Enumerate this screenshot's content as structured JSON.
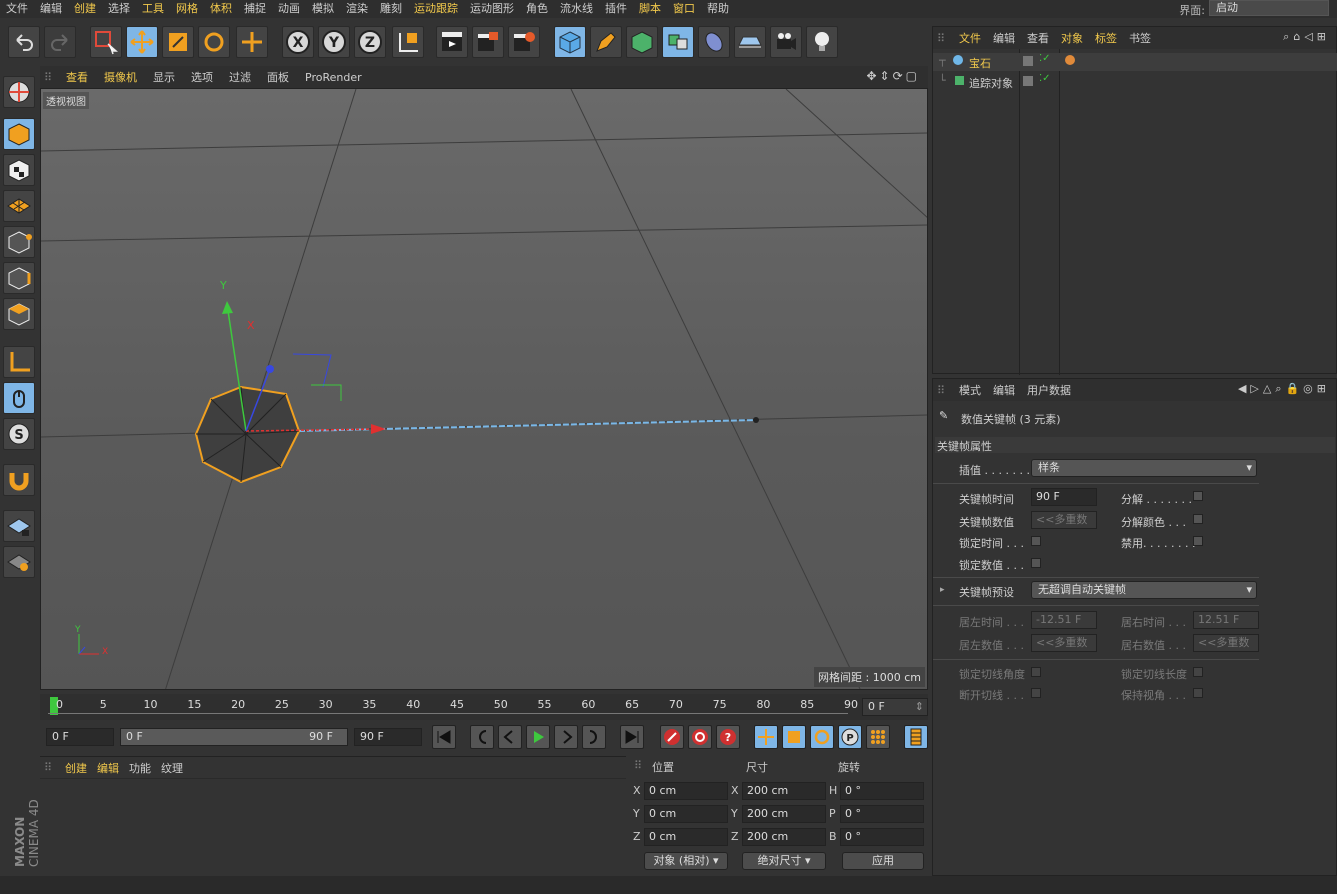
{
  "menubar": {
    "items": [
      "文件",
      "编辑",
      "创建",
      "选择",
      "工具",
      "网格",
      "体积",
      "捕捉",
      "动画",
      "模拟",
      "渲染",
      "雕刻",
      "运动跟踪",
      "运动图形",
      "角色",
      "流水线",
      "插件",
      "脚本",
      "窗口",
      "帮助"
    ],
    "highlighted": [
      "创建",
      "工具",
      "网格",
      "体积",
      "运动跟踪",
      "脚本",
      "窗口"
    ],
    "layout_label": "界面:",
    "layout_value": "启动"
  },
  "toolbar": {
    "icons": [
      "undo-icon",
      "redo-icon",
      "live-select-icon",
      "move-icon",
      "scale-icon",
      "rotate-icon",
      "last-tool-icon",
      "x-axis-icon",
      "y-axis-icon",
      "z-axis-icon",
      "coordinate-system-icon",
      "render-view-icon",
      "render-picture-viewer-icon",
      "render-settings-icon",
      "cube-icon",
      "pen-icon",
      "subdivision-icon",
      "array-icon",
      "deformer-icon",
      "floor-icon",
      "camera-icon",
      "light-icon"
    ],
    "axis_labels": [
      "X",
      "Y",
      "Z"
    ]
  },
  "viewport_menu": {
    "items": [
      "查看",
      "摄像机",
      "显示",
      "选项",
      "过滤",
      "面板",
      "ProRender"
    ],
    "highlighted": [
      "查看",
      "摄像机"
    ]
  },
  "viewport": {
    "title": "透视视图",
    "grid_distance": "网格间距 : 1000 cm",
    "axis_y": "Y",
    "axis_x": "X"
  },
  "timeline": {
    "ticks": [
      "0",
      "5",
      "10",
      "15",
      "20",
      "25",
      "30",
      "35",
      "40",
      "45",
      "50",
      "55",
      "60",
      "65",
      "70",
      "75",
      "80",
      "85",
      "90"
    ],
    "current_frame": "0 F"
  },
  "transport": {
    "start_field": "0 F",
    "range_start": "0 F",
    "range_end": "90 F",
    "end_field": "90 F"
  },
  "material_menu": {
    "items": [
      "创建",
      "编辑",
      "功能",
      "纹理"
    ],
    "highlighted": [
      "创建",
      "编辑"
    ]
  },
  "coords": {
    "headers": [
      "位置",
      "尺寸",
      "旋转"
    ],
    "rows": [
      {
        "axis": "X",
        "pos": "0 cm",
        "size_axis": "X",
        "size": "200 cm",
        "rot_axis": "H",
        "rot": "0 °"
      },
      {
        "axis": "Y",
        "pos": "0 cm",
        "size_axis": "Y",
        "size": "200 cm",
        "rot_axis": "P",
        "rot": "0 °"
      },
      {
        "axis": "Z",
        "pos": "0 cm",
        "size_axis": "Z",
        "size": "200 cm",
        "rot_axis": "B",
        "rot": "0 °"
      }
    ],
    "mode_select": "对象 (相对)",
    "size_select": "绝对尺寸",
    "apply_button": "应用"
  },
  "brand": {
    "maxon": "MAXON",
    "cinema": "CINEMA 4D"
  },
  "object_manager": {
    "menu": [
      "文件",
      "编辑",
      "查看",
      "对象",
      "标签",
      "书签"
    ],
    "highlighted": [
      "文件",
      "对象",
      "标签"
    ],
    "objects": [
      {
        "name": "宝石",
        "color": "#f2c94c"
      },
      {
        "name": "追踪对象",
        "color": "#cfcfcf"
      }
    ]
  },
  "attribute_manager": {
    "menu": [
      "模式",
      "编辑",
      "用户数据"
    ],
    "title": "数值关键帧 (3 元素)",
    "section": "关键帧属性",
    "interp_label": "插值 . . . . . . .",
    "interp_value": "样条",
    "key_time_label": "关键帧时间",
    "key_time_value": "90 F",
    "key_value_label": "关键帧数值",
    "key_value_value": "<<多重数",
    "lock_time_label": "锁定时间 . . .",
    "lock_value_label": "锁定数值 . . .",
    "breakdown_label": "分解 . . . . . . .",
    "breakdown_color_label": "分解颜色 . . .",
    "mute_label": "禁用. . . . . . . .",
    "preset_label": "关键帧预设",
    "preset_value": "无超调自动关键帧",
    "left_time_label": "居左时间 . . .",
    "left_time_value": "-12.51 F",
    "right_time_label": "居右时间 . . .",
    "right_time_value": "12.51 F",
    "left_value_label": "居左数值 . . .",
    "left_value_value": "<<多重数",
    "right_value_label": "居右数值 . . .",
    "right_value_value": "<<多重数",
    "lock_tangent_angle_label": "锁定切线角度",
    "lock_tangent_length_label": "锁定切线长度",
    "break_tangent_label": "断开切线 . . .",
    "keep_visual_label": "保持视角 . . ."
  }
}
